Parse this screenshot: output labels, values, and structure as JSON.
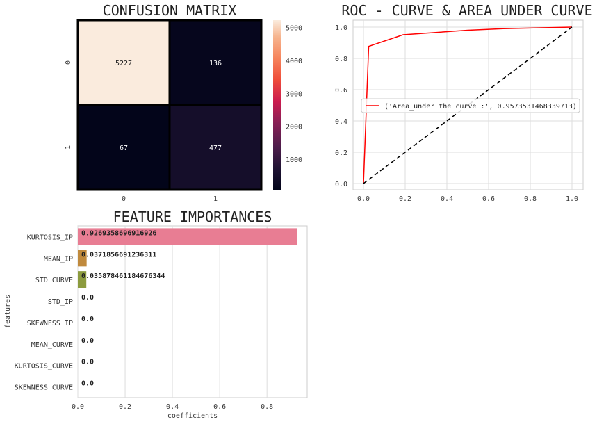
{
  "chart_data": [
    {
      "type": "heatmap",
      "title": "CONFUSION MATRIX",
      "rows": [
        "0",
        "1"
      ],
      "cols": [
        "0",
        "1"
      ],
      "values": [
        [
          5227,
          136
        ],
        [
          67,
          477
        ]
      ],
      "colorbar": {
        "ticks": [
          1000,
          2000,
          3000,
          4000,
          5000
        ],
        "min": 67,
        "max": 5227
      }
    },
    {
      "type": "line",
      "title": "ROC - CURVE & AREA UNDER CURVE",
      "xlim": [
        0.0,
        1.0
      ],
      "ylim": [
        0.0,
        1.0
      ],
      "xticks": [
        "0.0",
        "0.2",
        "0.4",
        "0.6",
        "0.8",
        "1.0"
      ],
      "yticks": [
        "0.0",
        "0.2",
        "0.4",
        "0.6",
        "0.8",
        "1.0"
      ],
      "grid": true,
      "legend_position": "center-right",
      "series": [
        {
          "name": "('Area_under the curve :', 0.9573531468339713)",
          "color": "#ff0000",
          "style": "solid",
          "x": [
            0.0,
            0.025,
            0.19,
            0.5,
            0.67,
            1.0
          ],
          "y": [
            0.0,
            0.877,
            0.951,
            0.98,
            0.99,
            1.0
          ]
        },
        {
          "name": "",
          "color": "#000000",
          "style": "dashed",
          "x": [
            0.0,
            1.0
          ],
          "y": [
            0.0,
            1.0
          ]
        }
      ]
    },
    {
      "type": "bar",
      "orientation": "horizontal",
      "title": "FEATURE IMPORTANCES",
      "xlabel": "coefficients",
      "ylabel": "features",
      "xlim": [
        0.0,
        0.97
      ],
      "xticks": [
        "0.0",
        "0.2",
        "0.4",
        "0.6",
        "0.8"
      ],
      "grid": true,
      "categories": [
        "KURTOSIS_IP",
        "MEAN_IP",
        "STD_CURVE",
        "STD_IP",
        "SKEWNESS_IP",
        "MEAN_CURVE",
        "KURTOSIS_CURVE",
        "SKEWNESS_CURVE"
      ],
      "values": [
        0.9269358696916926,
        0.0371856691236311,
        0.035878461184676344,
        0.0,
        0.0,
        0.0,
        0.0,
        0.0
      ],
      "value_labels": [
        "0.9269358696916926",
        "0.0371856691236311",
        "0.035878461184676344",
        "0.0",
        "0.0",
        "0.0",
        "0.0",
        "0.0"
      ],
      "colors": [
        "#e87d93",
        "#c08a3d",
        "#8c9b3e",
        "#4da859",
        "#48a99e",
        "#4da4c7",
        "#a094e0",
        "#e06fd6"
      ]
    }
  ]
}
